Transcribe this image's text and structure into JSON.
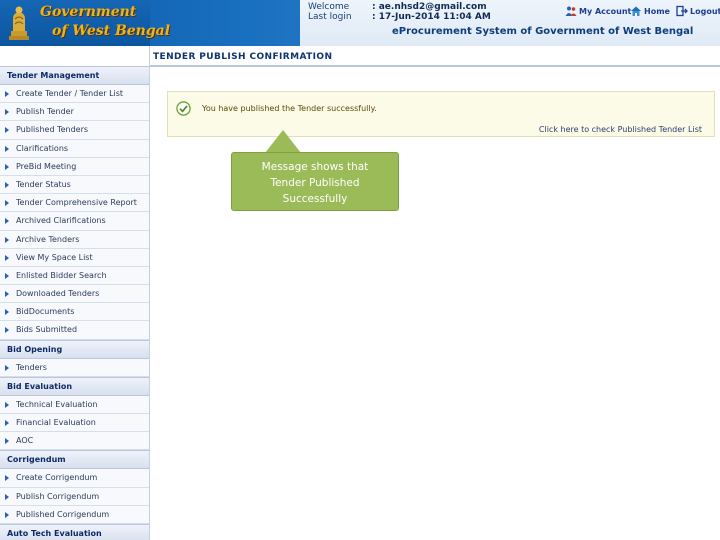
{
  "header": {
    "gov_line1": "Government",
    "gov_line2": "of West Bengal",
    "welcome_label": "Welcome",
    "welcome_value": ": ae.nhsd2@gmail.com",
    "last_login_label": "Last login",
    "last_login_value": ": 17-Jun-2014 11:04 AM",
    "links": [
      "My Account",
      "Home",
      "Logout"
    ],
    "portal_title": "eProcurement System of Government of West Bengal"
  },
  "sidebar": {
    "sections": [
      {
        "title": "Tender Management",
        "items": [
          "Create Tender / Tender List",
          "Publish Tender",
          "Published Tenders",
          "Clarifications",
          "PreBid Meeting",
          "Tender Status",
          "Tender Comprehensive Report",
          "Archived Clarifications",
          "Archive Tenders",
          "View My Space List",
          "Enlisted Bidder Search",
          "Downloaded Tenders",
          "BidDocuments",
          "Bids Submitted"
        ]
      },
      {
        "title": "Bid Opening",
        "items": [
          "Tenders"
        ]
      },
      {
        "title": "Bid Evaluation",
        "items": [
          "Technical Evaluation",
          "Financial Evaluation",
          "AOC"
        ]
      },
      {
        "title": "Corrigendum",
        "items": [
          "Create Corrigendum",
          "Publish Corrigendum",
          "Published Corrigendum"
        ]
      },
      {
        "title": "Auto Tech Evaluation",
        "items": []
      }
    ]
  },
  "main": {
    "page_title": "TENDER PUBLISH CONFIRMATION",
    "success_message": "You have published the Tender successfully.",
    "tender_list_link": "Click here to check Published Tender List"
  },
  "callout": {
    "line1": "Message shows that",
    "line2": "Tender Published",
    "line3": "Successfully"
  },
  "colors": {
    "header_blue": "#0b5aa8",
    "callout_green": "#9bbb59",
    "success_bg": "#fbfbe8"
  }
}
